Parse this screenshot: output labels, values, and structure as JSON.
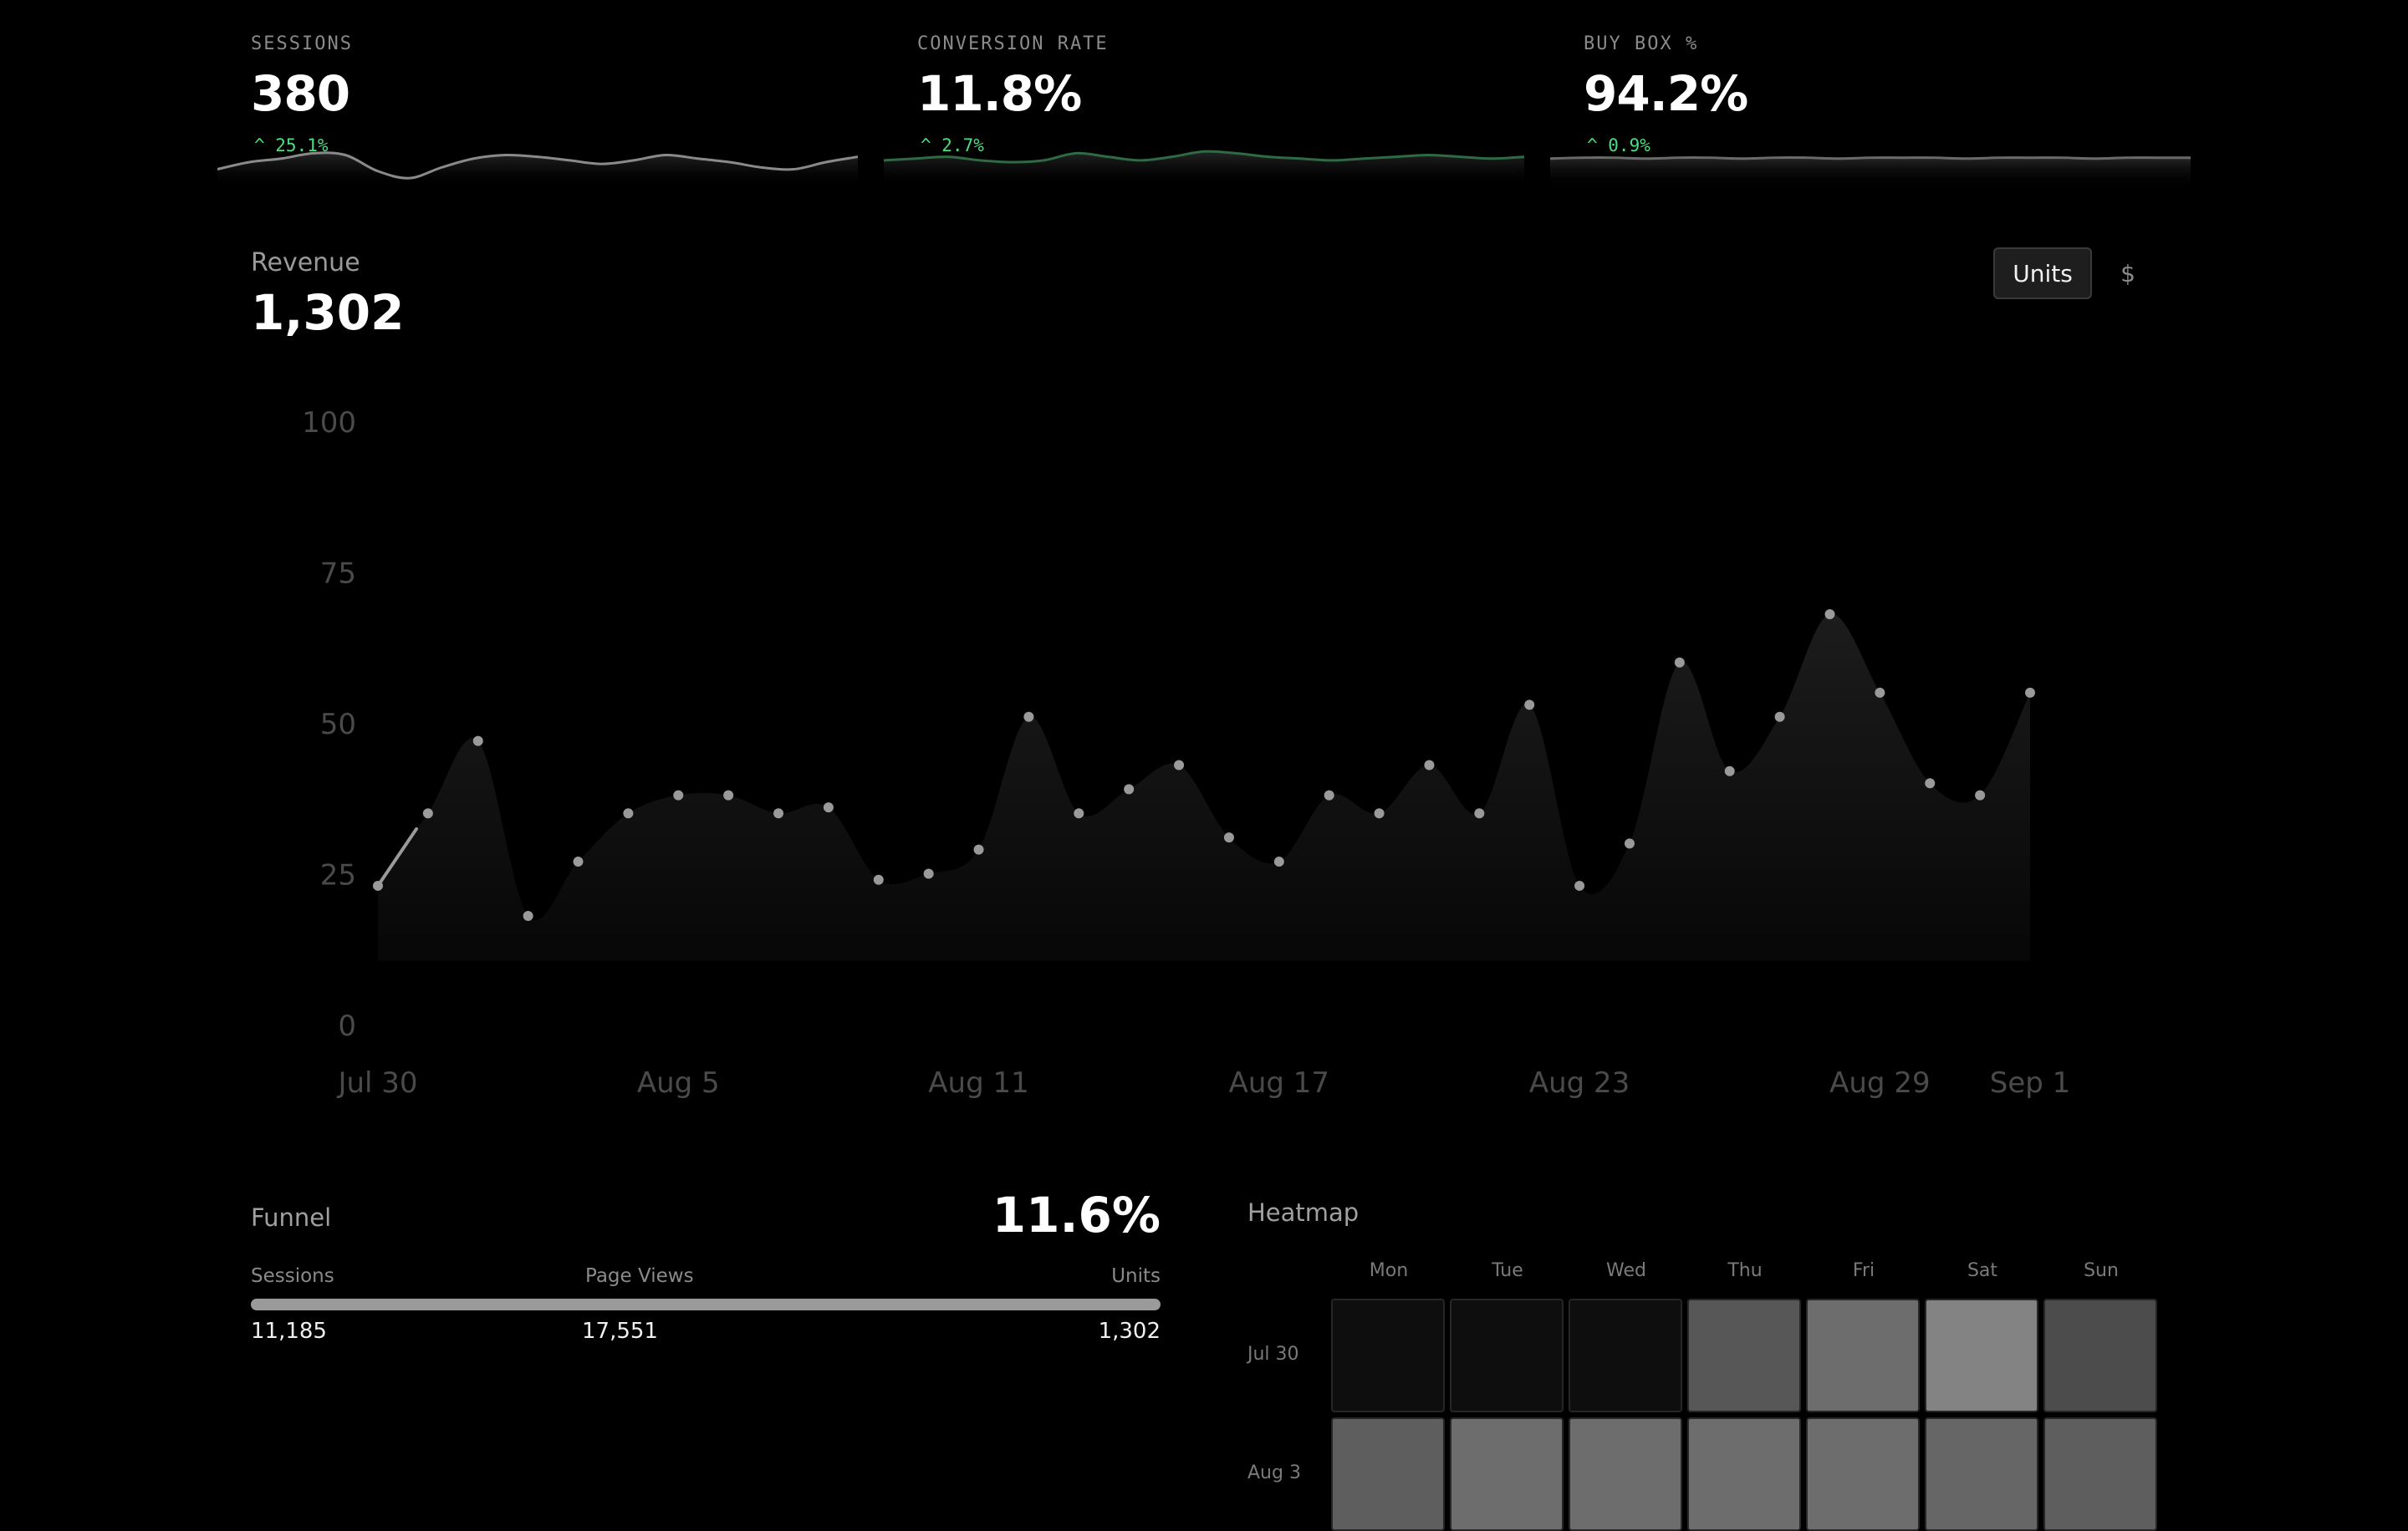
{
  "kpis": [
    {
      "label": "SESSIONS",
      "value": "380",
      "delta": "^ 25.1%",
      "spark": [
        40,
        48,
        52,
        58,
        56,
        38,
        30,
        42,
        52,
        56,
        54,
        50,
        46,
        50,
        56,
        52,
        48,
        42,
        40,
        48,
        54
      ],
      "spark_color": "#8a8a8a"
    },
    {
      "label": "CONVERSION RATE",
      "value": "11.8%",
      "delta": "^ 2.7%",
      "spark": [
        50,
        52,
        54,
        50,
        48,
        50,
        58,
        54,
        50,
        54,
        60,
        58,
        54,
        52,
        50,
        52,
        54,
        56,
        54,
        52,
        54
      ],
      "spark_color": "#2f6a44"
    },
    {
      "label": "BUY BOX %",
      "value": "94.2%",
      "delta": "^ 0.9%",
      "spark": [
        52,
        53,
        53,
        52,
        53,
        53,
        52,
        53,
        53,
        52,
        53,
        53,
        53,
        52,
        53,
        53,
        53,
        52,
        53,
        53,
        53
      ],
      "spark_color": "#6a6a6a"
    }
  ],
  "revenue": {
    "label": "Revenue",
    "value": "1,302",
    "toggle_units": "Units",
    "toggle_dollar": "$"
  },
  "chart_data": {
    "type": "area",
    "ylim": [
      0,
      100
    ],
    "yticks": [
      0,
      25,
      50,
      75,
      100
    ],
    "x_tick_labels": [
      {
        "label": "Jul 30",
        "index": 0
      },
      {
        "label": "Aug 5",
        "index": 6
      },
      {
        "label": "Aug 11",
        "index": 12
      },
      {
        "label": "Aug 17",
        "index": 18
      },
      {
        "label": "Aug 23",
        "index": 24
      },
      {
        "label": "Aug 29",
        "index": 30
      },
      {
        "label": "Sep 1",
        "index": 33
      }
    ],
    "values": [
      23,
      35,
      47,
      18,
      27,
      35,
      38,
      38,
      35,
      36,
      24,
      25,
      29,
      51,
      35,
      39,
      43,
      31,
      27,
      38,
      35,
      43,
      35,
      53,
      23,
      30,
      60,
      42,
      51,
      68,
      55,
      40,
      38,
      55
    ],
    "color": "#9a9a9a"
  },
  "funnel": {
    "title": "Funnel",
    "rate": "11.6%",
    "columns": [
      {
        "label": "Sessions",
        "value": "11,185"
      },
      {
        "label": "Page Views",
        "value": "17,551"
      },
      {
        "label": "Units",
        "value": "1,302"
      }
    ]
  },
  "heatmap": {
    "title": "Heatmap",
    "days": [
      "Mon",
      "Tue",
      "Wed",
      "Thu",
      "Fri",
      "Sat",
      "Sun"
    ],
    "rows": [
      {
        "label": "Jul 30",
        "values": [
          0.02,
          0.02,
          0.02,
          0.35,
          0.45,
          0.55,
          0.3
        ]
      },
      {
        "label": "Aug 3",
        "values": [
          0.38,
          0.45,
          0.45,
          0.45,
          0.45,
          0.42,
          0.38
        ]
      }
    ]
  }
}
